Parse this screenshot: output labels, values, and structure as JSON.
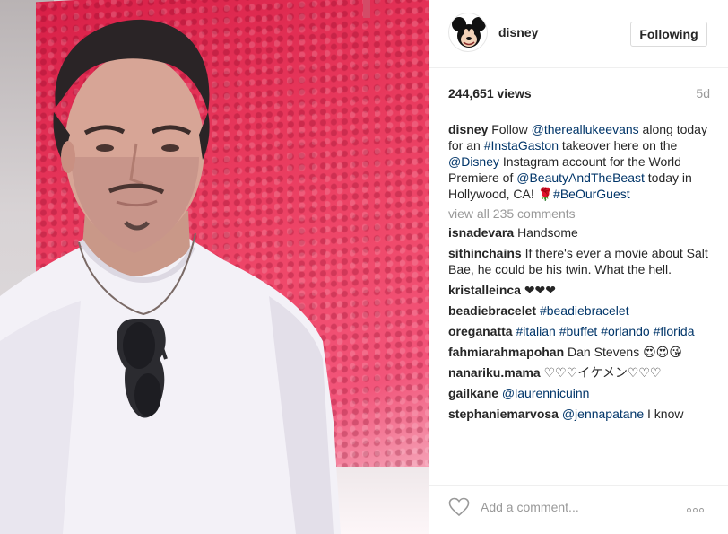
{
  "post": {
    "author": "disney",
    "follow_label": "Following",
    "views": "244,651 views",
    "age": "5d",
    "caption": {
      "username": "disney",
      "parts": [
        {
          "t": "Follow ",
          "link": false
        },
        {
          "t": "@thereallukeevans",
          "link": true
        },
        {
          "t": " along today for an ",
          "link": false
        },
        {
          "t": "#InstaGaston",
          "link": true
        },
        {
          "t": " takeover here on the ",
          "link": false
        },
        {
          "t": "@Disney",
          "link": true
        },
        {
          "t": " Instagram account for the World Premiere of ",
          "link": false
        },
        {
          "t": "@BeautyAndTheBeast",
          "link": true
        },
        {
          "t": " today in Hollywood, CA! 🌹",
          "link": false
        },
        {
          "t": "#BeOurGuest",
          "link": true
        }
      ]
    },
    "view_all": "view all 235 comments",
    "comments": [
      {
        "user": "isnadevara",
        "parts": [
          {
            "t": "Handsome",
            "link": false
          }
        ]
      },
      {
        "user": "sithinchains",
        "parts": [
          {
            "t": "If there's ever a movie about Salt Bae, he could be his twin. What the hell.",
            "link": false
          }
        ]
      },
      {
        "user": "kristalleinca",
        "parts": [
          {
            "t": "❤❤❤",
            "link": false
          }
        ]
      },
      {
        "user": "beadiebracelet",
        "parts": [
          {
            "t": "#beadiebracelet",
            "link": true
          }
        ]
      },
      {
        "user": "oreganatta",
        "parts": [
          {
            "t": "#italian",
            "link": true
          },
          {
            "t": " ",
            "link": false
          },
          {
            "t": "#buffet",
            "link": true
          },
          {
            "t": " ",
            "link": false
          },
          {
            "t": "#orlando",
            "link": true
          },
          {
            "t": " ",
            "link": false
          },
          {
            "t": "#florida",
            "link": true
          }
        ]
      },
      {
        "user": "fahmiarahmapohan",
        "parts": [
          {
            "t": "Dan Stevens 😍😍😘",
            "link": false
          }
        ]
      },
      {
        "user": "nanariku.mama",
        "parts": [
          {
            "t": "♡♡♡イケメン♡♡♡",
            "link": false
          }
        ]
      },
      {
        "user": "gailkane",
        "parts": [
          {
            "t": "@laurennicuinn",
            "link": true
          }
        ]
      },
      {
        "user": "stephaniemarvosa",
        "parts": [
          {
            "t": "@jennapatane",
            "link": true
          },
          {
            "t": " I know",
            "link": false
          }
        ]
      }
    ],
    "add_comment_placeholder": "Add a comment..."
  },
  "icons": {
    "like": "heart-icon",
    "more": "more-options-icon",
    "avatar": "mickey-avatar"
  },
  "colors": {
    "link": "#003569",
    "muted": "#999999",
    "text": "#262626",
    "wall": "#e8385c"
  }
}
